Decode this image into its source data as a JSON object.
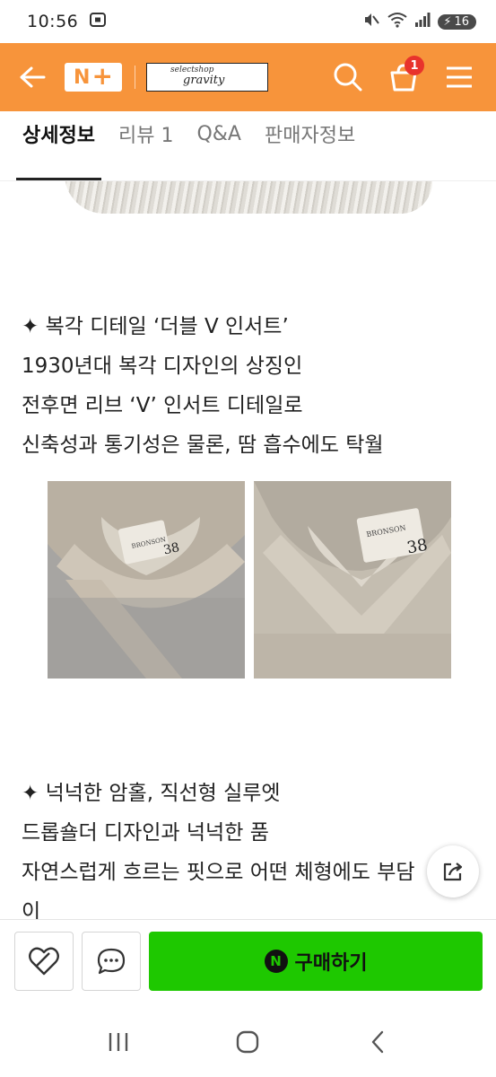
{
  "status_bar": {
    "time": "10:56",
    "battery": "16"
  },
  "header": {
    "nplus_letter": "N",
    "nplus_symbol": "+",
    "shop_logo_line1": "selectshop",
    "shop_logo_line2": "gravity",
    "cart_count": "1",
    "accent_color": "#f7943b"
  },
  "tabs": [
    {
      "label": "상세정보",
      "active": true
    },
    {
      "label": "리뷰 1",
      "active": false
    },
    {
      "label": "Q&A",
      "active": false
    },
    {
      "label": "판매자정보",
      "active": false
    }
  ],
  "section1": {
    "lines": [
      "✦ 복각 디테일 ‘더블 V 인서트’",
      "1930년대 복각 디자인의 상징인",
      "전후면 리브 ‘V’ 인서트 디테일로",
      "신축성과 통기성은 물론, 땀 흡수에도 탁월"
    ]
  },
  "photos": [
    {
      "tag_brand": "BRONSON",
      "tag_size": "38"
    },
    {
      "tag_brand": "BRONSON",
      "tag_size": "38"
    }
  ],
  "section2": {
    "lines": [
      "✦ 넉넉한 암홀, 직선형 실루엣",
      "드롭숄더 디자인과 넉넉한 품",
      "자연스럽게 흐르는 핏으로 어떤 체형에도 부담",
      "이"
    ]
  },
  "bottom_bar": {
    "buy_icon_letter": "N",
    "buy_label": "구매하기",
    "buy_color": "#1ec800"
  }
}
